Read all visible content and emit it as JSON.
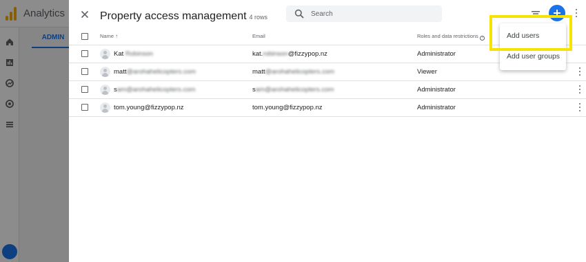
{
  "app": {
    "title": "Analytics",
    "admin_tab": "ADMIN"
  },
  "panel": {
    "breadcrumb": "",
    "title": "Property access management",
    "row_count": "4 rows",
    "search_placeholder": "Search"
  },
  "table": {
    "headers": {
      "name": "Name",
      "sort_indicator": "↑",
      "email": "Email",
      "roles": "Roles and data restrictions"
    },
    "rows": [
      {
        "name": "Kat",
        "email_visible_prefix": "kat.",
        "email_visible_suffix": "@fizzypop.nz",
        "role": "Administrator"
      },
      {
        "name": "matt",
        "email_visible_prefix": "matt",
        "email_visible_suffix": "",
        "role": "Viewer"
      },
      {
        "name": "s",
        "email_visible_prefix": "s",
        "email_visible_suffix": "",
        "role": "Administrator"
      },
      {
        "name": "tom.young@fizzypop.nz",
        "email_visible_prefix": "tom.young@fizzypop.nz",
        "email_visible_suffix": "",
        "role": "Administrator"
      }
    ]
  },
  "menu": {
    "add_users": "Add users",
    "add_user_groups": "Add user groups"
  },
  "colors": {
    "accent": "#1a73e8",
    "highlight": "#f4e400",
    "logo": "#f9ab00"
  }
}
